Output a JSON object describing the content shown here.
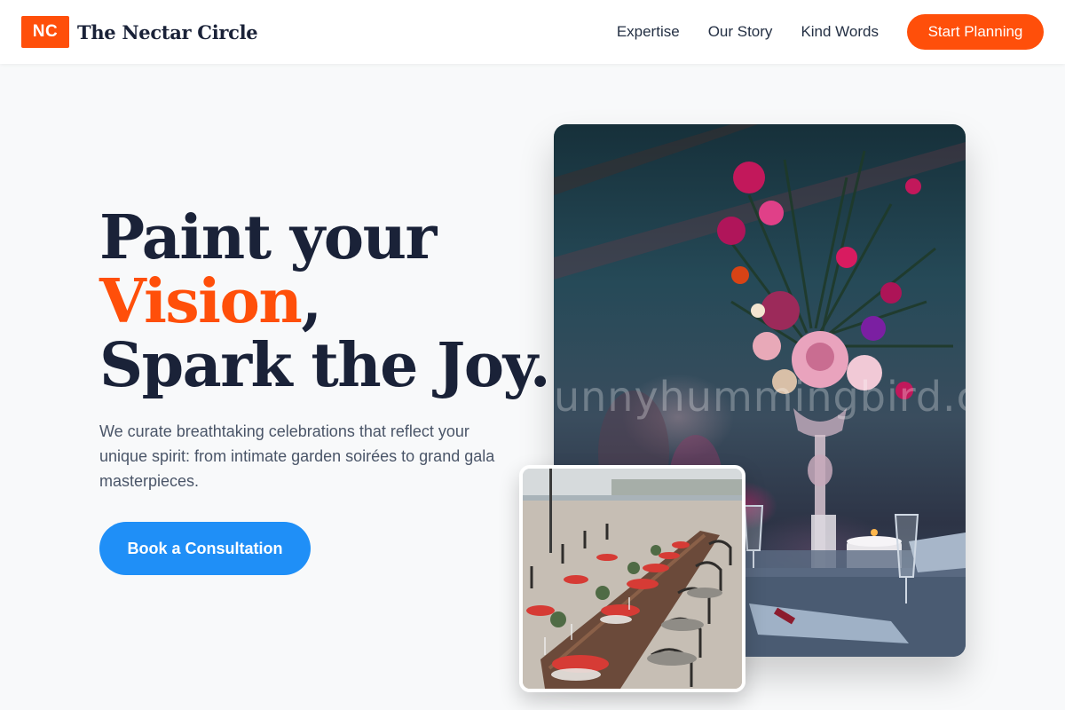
{
  "brand": {
    "mark": "NC",
    "name": "The Nectar Circle"
  },
  "nav": {
    "links": [
      "Expertise",
      "Our Story",
      "Kind Words"
    ],
    "cta_label": "Start Planning"
  },
  "hero": {
    "title_line1": "Paint your",
    "title_accent": "Vision",
    "title_comma": ",",
    "title_line3": "Spark the Joy.",
    "subtitle": "We curate breathtaking celebrations that reflect your unique spirit: from intimate garden soirées to grand gala masterpieces.",
    "cta_label": "Book a Consultation"
  },
  "images": {
    "main_watermark": "unnyhummingbird.com"
  },
  "colors": {
    "accent": "#ff4f0a",
    "primary_button": "#1f8ff7",
    "heading": "#1a2238",
    "body_text": "#4a5568",
    "page_background": "#f8f9fa"
  }
}
